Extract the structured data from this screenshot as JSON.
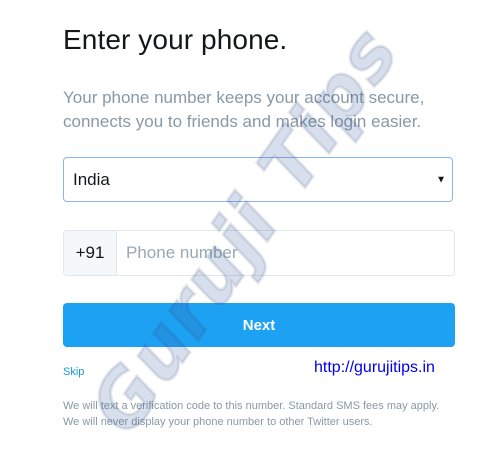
{
  "page": {
    "title": "Enter your phone.",
    "subtitle": "Your phone number keeps your account secure, connects you to friends and makes login easier."
  },
  "country_select": {
    "value": "India",
    "caret_icon": "dropdown-caret-icon"
  },
  "phone": {
    "prefix": "+91",
    "placeholder": "Phone number",
    "value": ""
  },
  "buttons": {
    "next_label": "Next",
    "skip_label": "Skip"
  },
  "site_url": "http://gurujitips.in",
  "footnote": "We will text a verification code to this number. Standard SMS fees may apply. We will never display your phone number to other Twitter users.",
  "watermark": "Guruji Tips",
  "colors": {
    "primary": "#1da1f2",
    "link": "#1b95e0",
    "muted_text": "#8899a6",
    "heading_text": "#14171a"
  }
}
